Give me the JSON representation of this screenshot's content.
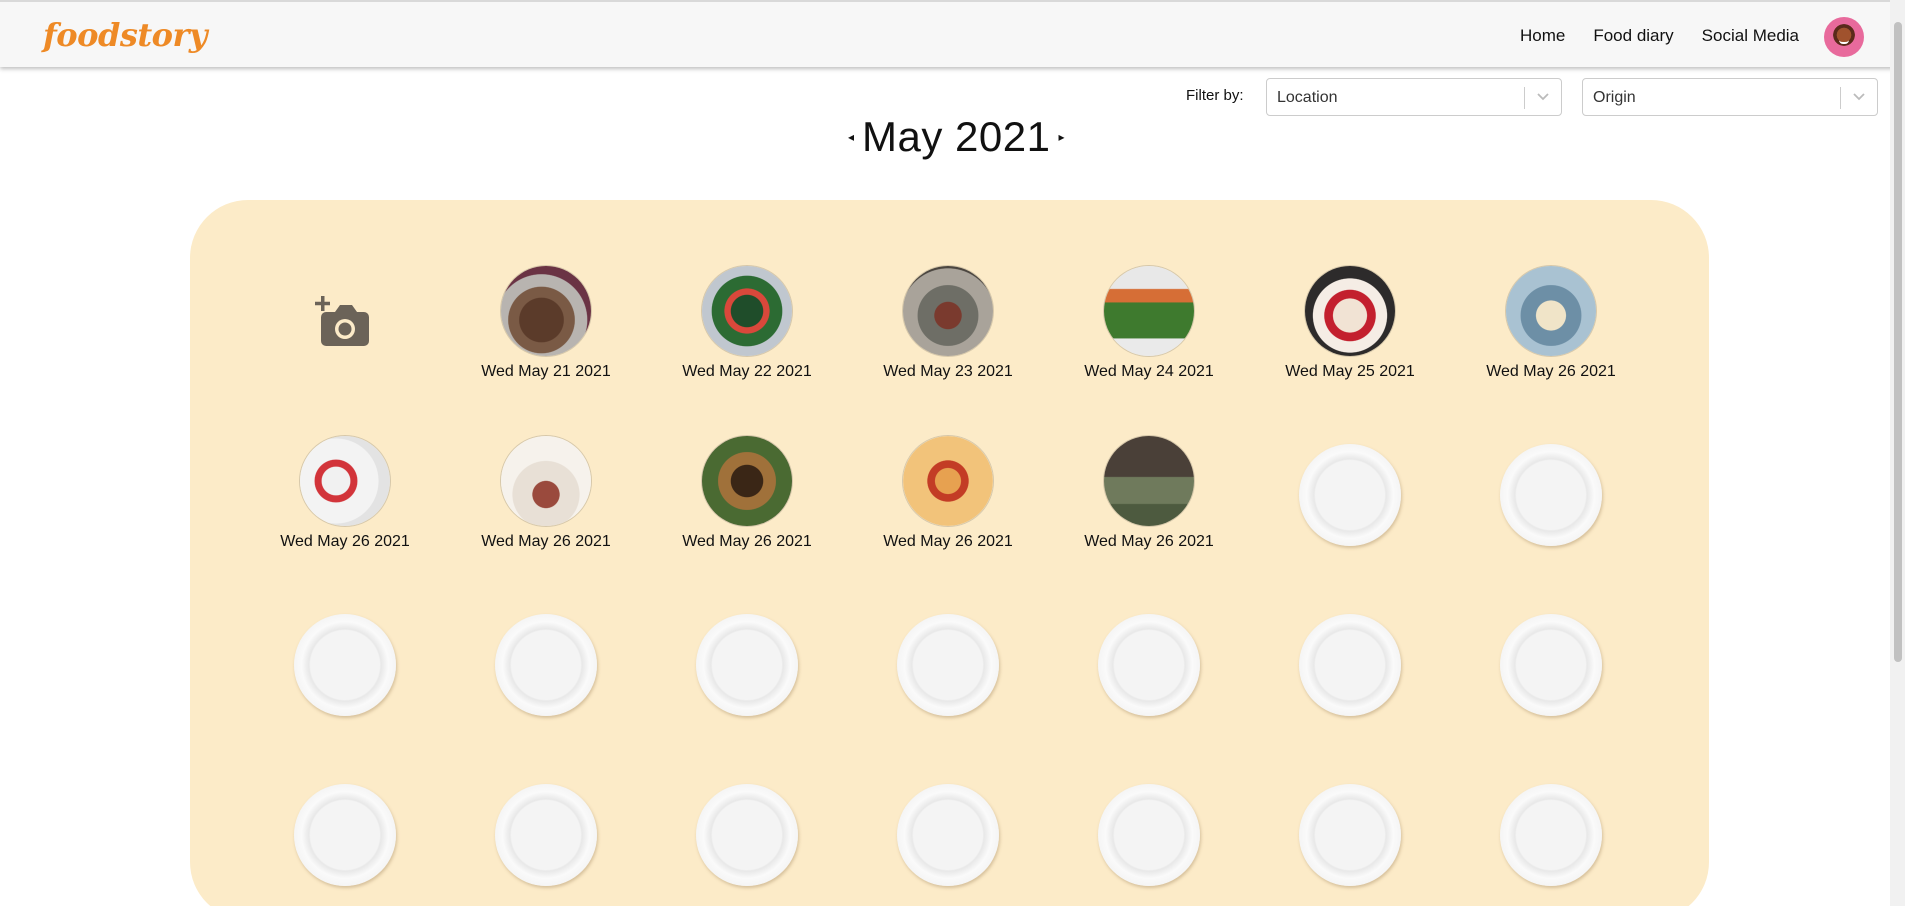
{
  "app": {
    "logo": "foodstory"
  },
  "nav": {
    "items": [
      {
        "label": "Home"
      },
      {
        "label": "Food diary"
      },
      {
        "label": "Social Media"
      }
    ]
  },
  "filter": {
    "label": "Filter by:",
    "location": "Location",
    "origin": "Origin"
  },
  "calendar": {
    "month": "May 2021"
  },
  "entries": [
    {
      "date": "Wed May 21 2021"
    },
    {
      "date": "Wed May 22 2021"
    },
    {
      "date": "Wed May 23 2021"
    },
    {
      "date": "Wed May 24 2021"
    },
    {
      "date": "Wed May 25 2021"
    },
    {
      "date": "Wed May 26 2021"
    },
    {
      "date": "Wed May 26 2021"
    },
    {
      "date": "Wed May 26 2021"
    },
    {
      "date": "Wed May 26 2021"
    },
    {
      "date": "Wed May 26 2021"
    },
    {
      "date": "Wed May 26 2021"
    }
  ],
  "colors": {
    "brand": "#ee8a26",
    "panel": "#fcebc8"
  },
  "icons": {
    "add": "add-photo-icon",
    "prev": "prev-month-icon",
    "next": "next-month-icon",
    "dropdown": "chevron-down-icon"
  }
}
